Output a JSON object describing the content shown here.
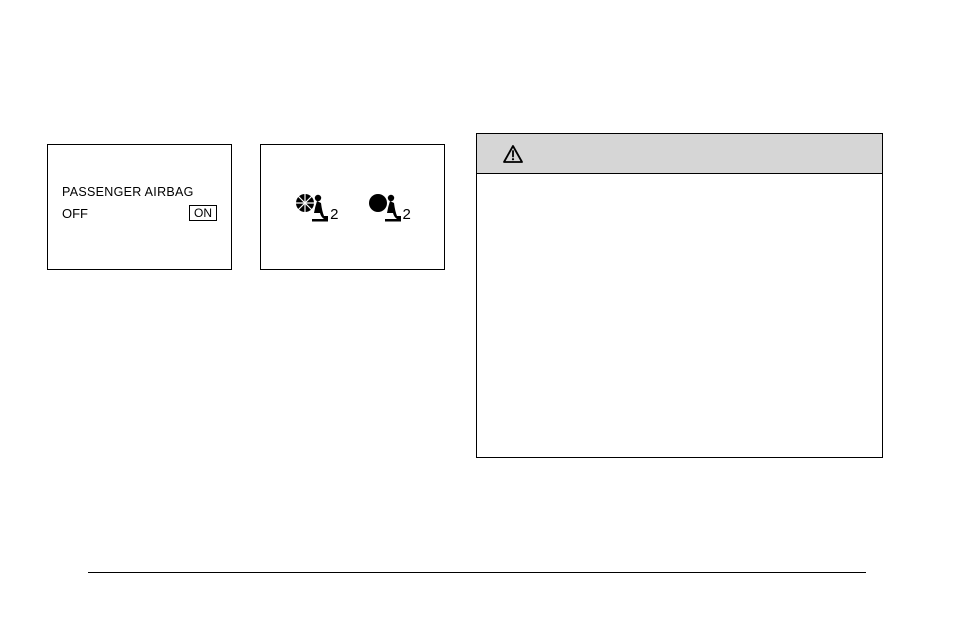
{
  "panel1": {
    "title": "PASSENGER AIRBAG",
    "off": "OFF",
    "on": "ON"
  },
  "panel2": {
    "icon1_num": "2",
    "icon2_num": "2"
  }
}
